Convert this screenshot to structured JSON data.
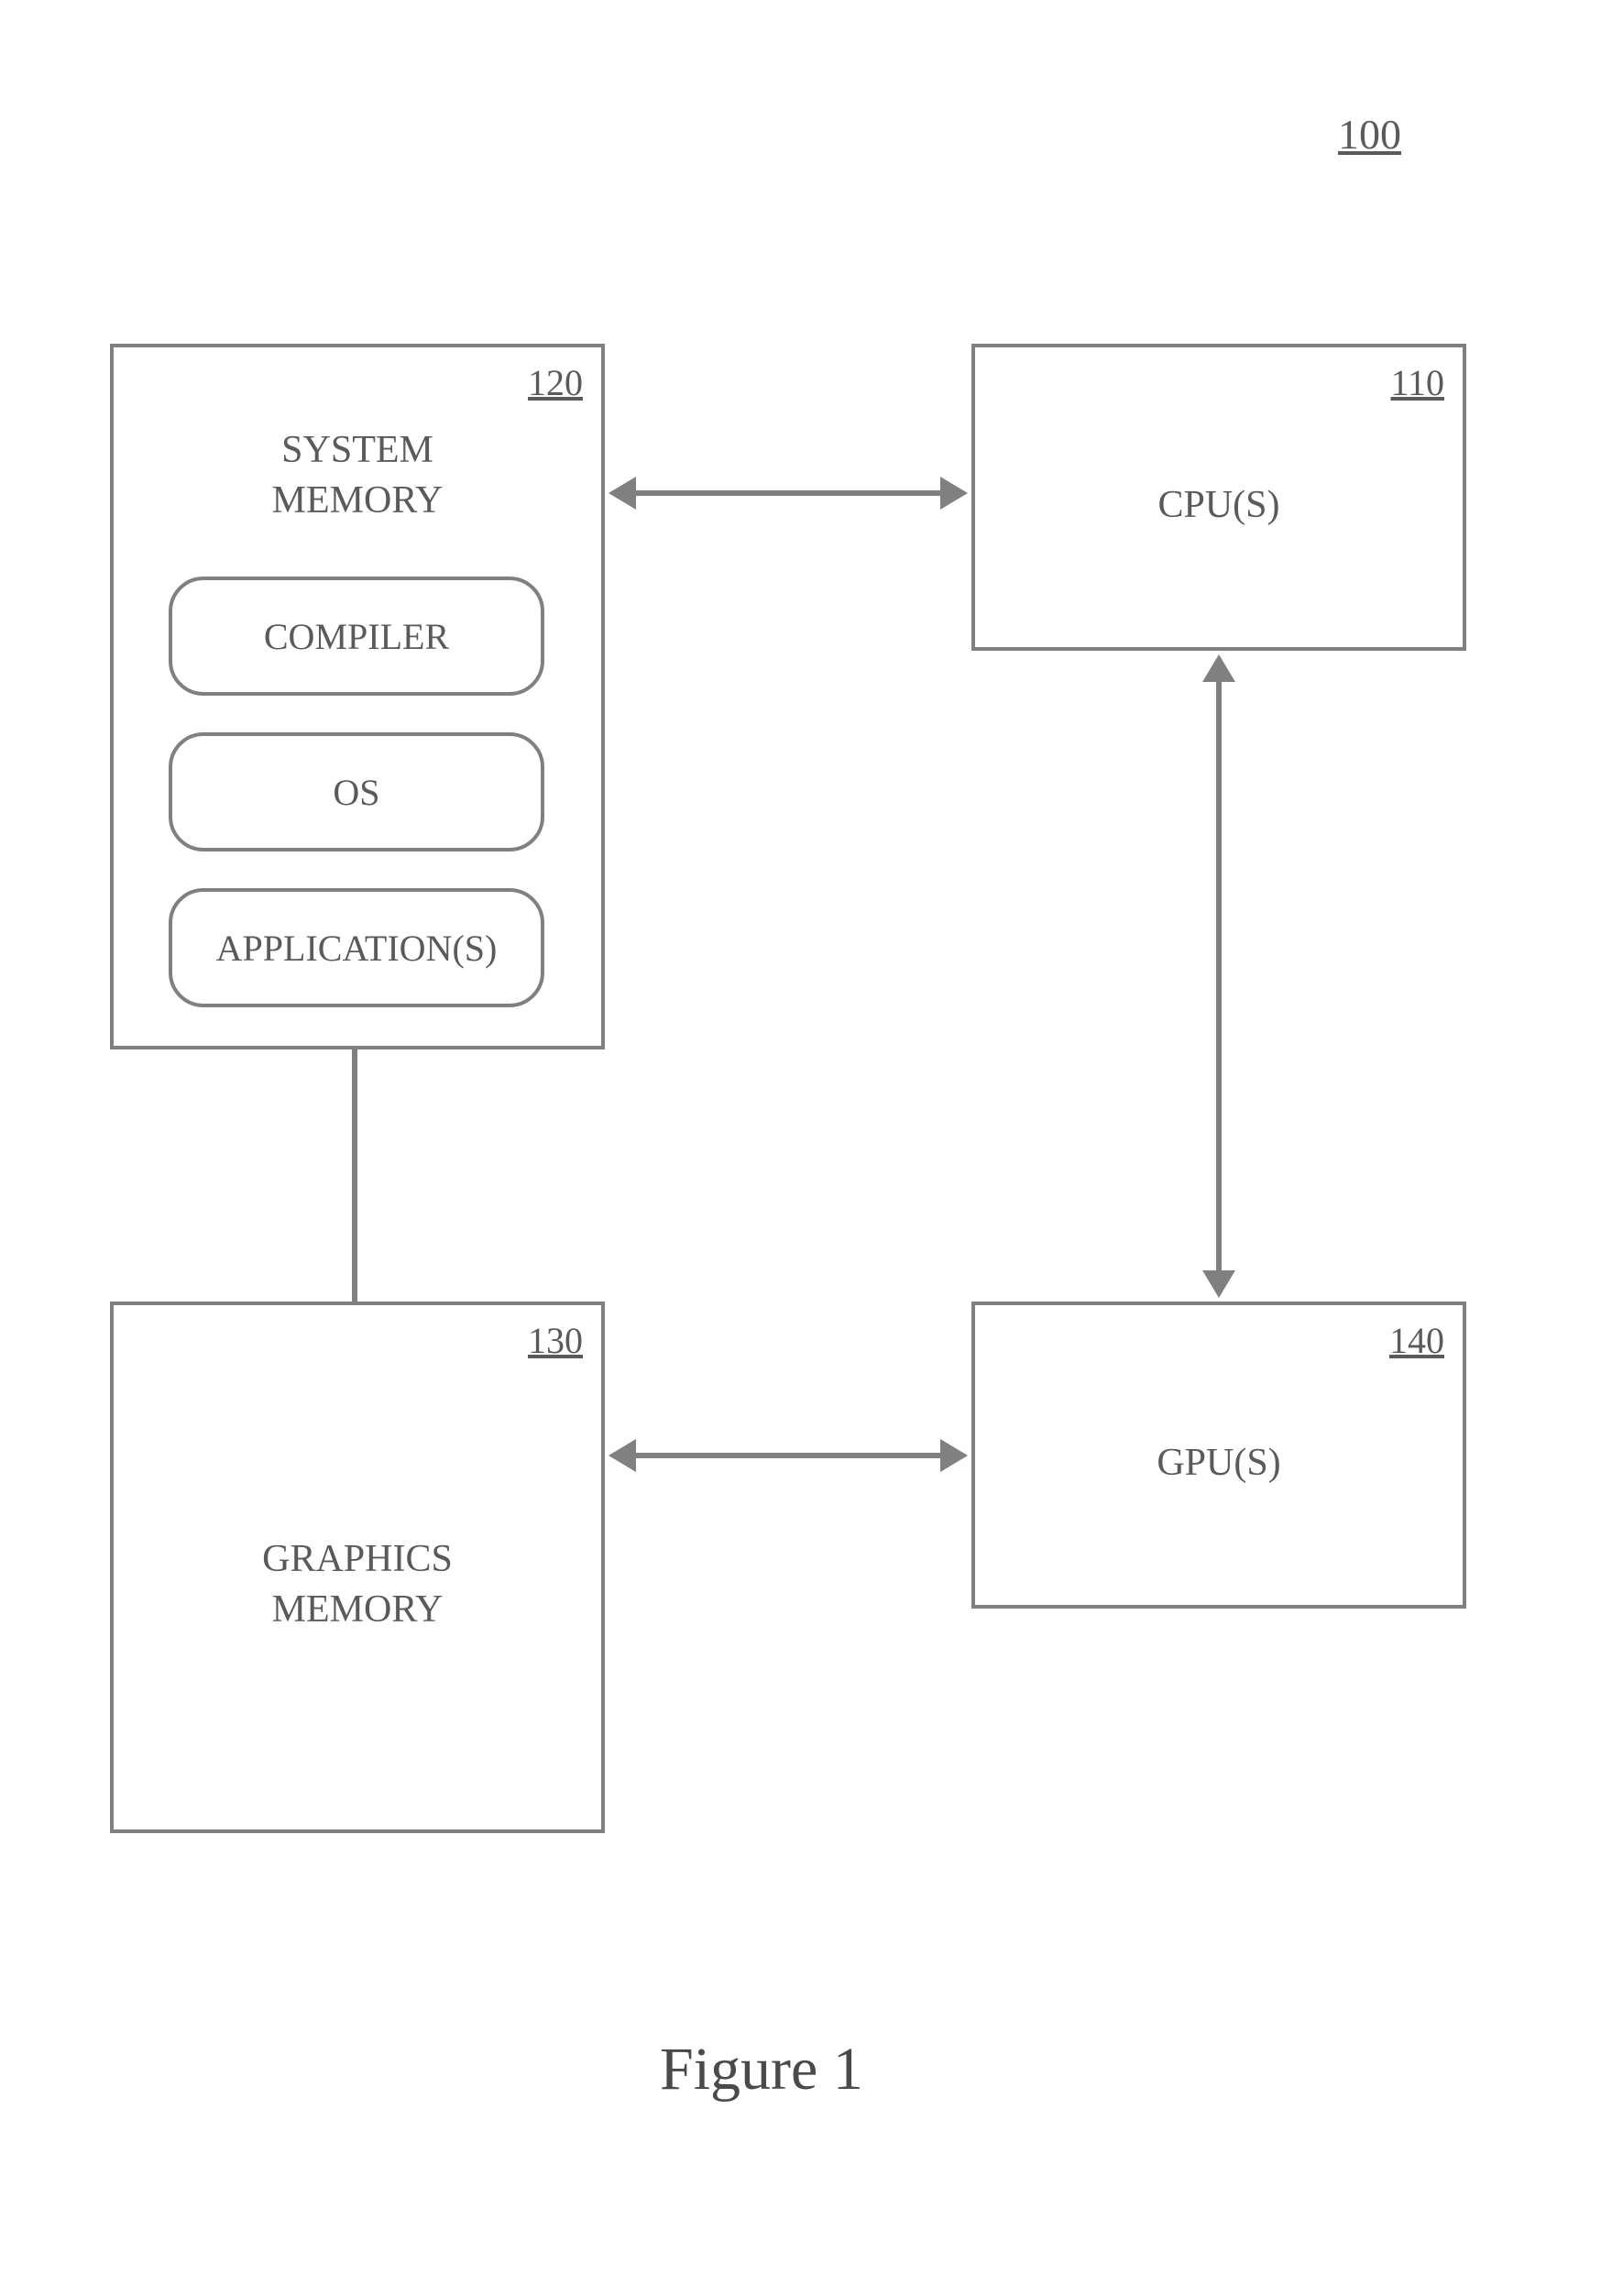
{
  "figure": {
    "ref": "100",
    "caption": "Figure 1"
  },
  "boxes": {
    "system_memory": {
      "ref": "120",
      "label": "SYSTEM\nMEMORY",
      "items": {
        "compiler": "COMPILER",
        "os": "OS",
        "applications": "APPLICATION(S)"
      }
    },
    "cpu": {
      "ref": "110",
      "label": "CPU(S)"
    },
    "graphics_memory": {
      "ref": "130",
      "label": "GRAPHICS\nMEMORY"
    },
    "gpu": {
      "ref": "140",
      "label": "GPU(S)"
    }
  },
  "connections": [
    {
      "from": "system_memory",
      "to": "cpu",
      "bidirectional": true
    },
    {
      "from": "graphics_memory",
      "to": "gpu",
      "bidirectional": true
    },
    {
      "from": "cpu",
      "to": "gpu",
      "bidirectional": true
    },
    {
      "from": "system_memory",
      "to": "graphics_memory",
      "bidirectional": false
    }
  ]
}
